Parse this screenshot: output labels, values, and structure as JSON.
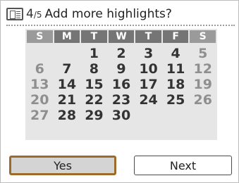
{
  "header": {
    "icon": "book-icon",
    "step_current": "4",
    "step_sep": "/",
    "step_total": "5",
    "title": "Add more highlights?"
  },
  "calendar": {
    "weekdays": [
      "S",
      "M",
      "T",
      "W",
      "T",
      "F",
      "S"
    ],
    "weeks": [
      [
        "",
        "",
        "1",
        "2",
        "3",
        "4",
        "5"
      ],
      [
        "6",
        "7",
        "8",
        "9",
        "10",
        "11",
        "12"
      ],
      [
        "13",
        "14",
        "15",
        "16",
        "17",
        "18",
        "19"
      ],
      [
        "20",
        "21",
        "22",
        "23",
        "24",
        "25",
        "26"
      ],
      [
        "27",
        "28",
        "29",
        "30",
        "",
        "",
        ""
      ]
    ]
  },
  "buttons": {
    "yes_label": "Yes",
    "next_label": "Next"
  },
  "colors": {
    "highlight_border": "#9c6b2a",
    "weekday_header": "#757575",
    "weekend_text": "#8f8f8f"
  }
}
